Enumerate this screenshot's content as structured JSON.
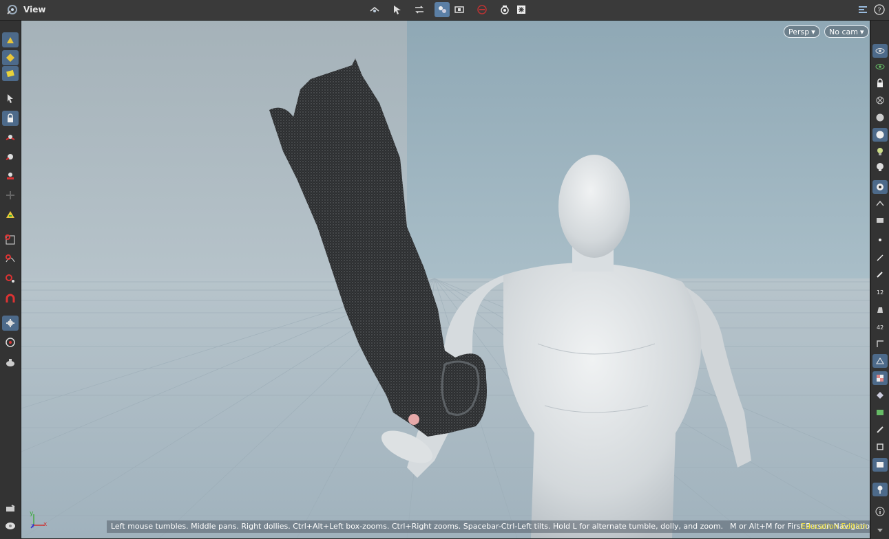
{
  "toolbar": {
    "view_label": "View"
  },
  "viewport": {
    "camera_menu": "Persp",
    "cam_menu": "No cam",
    "status_text": "Left mouse tumbles. Middle pans. Right dollies. Ctrl+Alt+Left box-zooms. Ctrl+Right zooms. Spacebar-Ctrl-Left tilts. Hold L for alternate tumble, dolly, and zoom.",
    "nav_hint": "M or Alt+M for First Person Navigation.",
    "edition_badge": "Education Edition",
    "axis_labels": {
      "x": "x",
      "y": "y",
      "z": "z"
    }
  },
  "colors": {
    "accent": "#5b7fa5",
    "edition": "#f2e33a",
    "viewport_bg": "#a3b4bf"
  },
  "icons": {
    "top": [
      "view-menu-icon",
      "tumble-icon",
      "select-arrow-icon",
      "transform-icon",
      "ghost-objects-icon",
      "camera-icon",
      "no-entry-icon",
      "snapshot-icon",
      "render-icon",
      "display-options-icon",
      "help-icon"
    ],
    "left": [
      "paint-brush-icon",
      "paint-select-icon",
      "paint-tool-icon",
      "select-arrow-icon",
      "lock-select-icon",
      "move-tool-icon",
      "rotate-tool-icon",
      "scale-tool-icon",
      "handle-tool-icon",
      "pose-tool-icon",
      "snap-grid-icon",
      "snap-curve-icon",
      "snap-point-icon",
      "magnet-icon",
      "view-tool-icon",
      "render-region-icon",
      "teapot-icon",
      "camera-flip-icon",
      "light-bulb-icon"
    ],
    "right": [
      "eye-icon",
      "ghost-eye-icon",
      "lock-icon",
      "link-icon",
      "sphere-icon",
      "shaded-sphere-icon",
      "light-icon",
      "skull-icon",
      "scene-icon",
      "camera-eye-icon",
      "ortho-icon",
      "point-icon",
      "normal-icon",
      "pen-icon",
      "number-12-icon",
      "hand-icon",
      "number-42-icon",
      "angle-icon",
      "wireframe-icon",
      "checker-icon",
      "diamond-icon",
      "guard-icon",
      "bone-icon",
      "display-icon",
      "screen-icon",
      "pin-icon",
      "info-icon",
      "scroll-down-icon"
    ]
  }
}
